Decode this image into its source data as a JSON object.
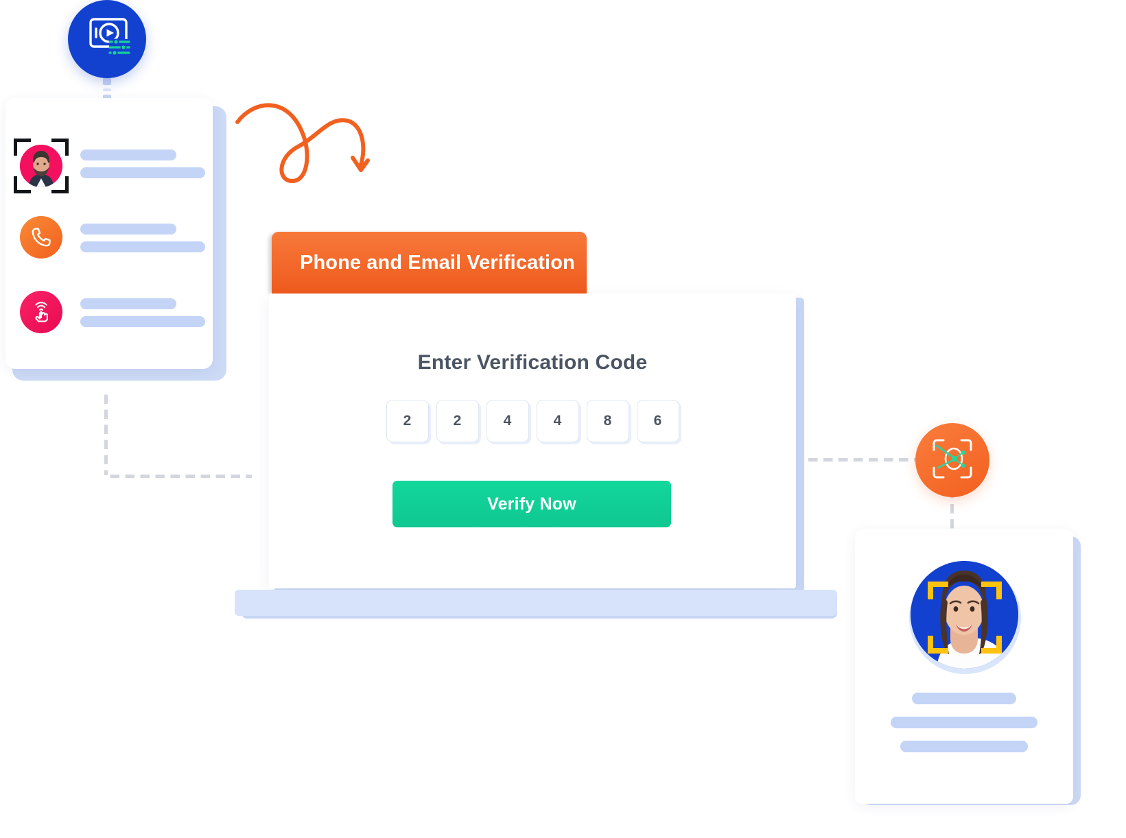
{
  "scene": {
    "title": "Phone and Email Verification identity flow illustration"
  },
  "media_badge": {
    "icon": "video-player-settings-icon",
    "circle_color": "#1341cf",
    "accent_color": "#1ec98f"
  },
  "left_card": {
    "name": "identity-document-card",
    "rows": [
      {
        "icon": "face-scan-avatar-icon",
        "icon_color": "#f4105f",
        "bars": [
          2,
          1
        ]
      },
      {
        "icon": "phone-call-icon",
        "icon_color": "#f2731f",
        "bars": [
          2,
          1
        ]
      },
      {
        "icon": "fingerprint-touch-icon",
        "icon_color": "#f4105f",
        "bars": [
          2,
          1
        ]
      }
    ],
    "placeholder_bar_color": "#c3d4f7"
  },
  "squiggle": {
    "name": "decorative-curved-arrow",
    "color": "#f2601f"
  },
  "banner": {
    "title": "Phone and Email Verification",
    "background_color": "#ef5a1d",
    "text_color": "#ffffff"
  },
  "laptop": {
    "screen_background": "#ffffff",
    "base_color": "#d7e2fb",
    "heading": "Enter Verification Code",
    "heading_color": "#4b5563",
    "code": {
      "digits": [
        "2",
        "2",
        "4",
        "4",
        "8",
        "6"
      ],
      "box_border_color": "#dfe6f3",
      "digit_color": "#4b5563"
    },
    "verify_button": {
      "label": "Verify Now",
      "background_color": "#10cf96",
      "text_color": "#ffffff"
    }
  },
  "scan_badge": {
    "icon": "face-scan-frame-icon",
    "circle_color": "#f2601f",
    "accent_color": "#2fd19c"
  },
  "right_card": {
    "name": "verified-profile-card",
    "avatar": {
      "icon": "woman-portrait-avatar",
      "circle_color": "#1341cf",
      "scan_frame_color": "#ffc20e"
    },
    "bars": [
      3
    ]
  },
  "connectors": {
    "color": "#d3d6de",
    "style": "dashed"
  }
}
